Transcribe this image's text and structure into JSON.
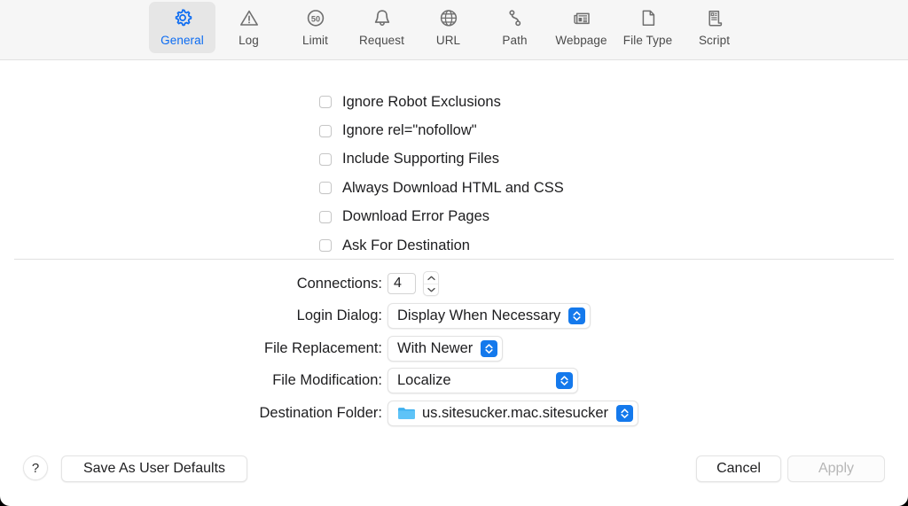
{
  "window": {
    "accent_color": "#1479ec",
    "toolbar_bg": "#f6f6f6"
  },
  "toolbar": {
    "tabs": [
      {
        "label": "General",
        "icon": "gear-icon",
        "selected": true
      },
      {
        "label": "Log",
        "icon": "warning-triangle-icon",
        "selected": false
      },
      {
        "label": "Limit",
        "icon": "speed-limit-50-icon",
        "selected": false
      },
      {
        "label": "Request",
        "icon": "bell-icon",
        "selected": false
      },
      {
        "label": "URL",
        "icon": "globe-icon",
        "selected": false
      },
      {
        "label": "Path",
        "icon": "path-node-icon",
        "selected": false
      },
      {
        "label": "Webpage",
        "icon": "newspaper-icon",
        "selected": false
      },
      {
        "label": "File Type",
        "icon": "document-page-icon",
        "selected": false
      },
      {
        "label": "Script",
        "icon": "scroll-script-icon",
        "selected": false
      }
    ]
  },
  "checkboxes": [
    {
      "label": "Ignore Robot Exclusions",
      "checked": false
    },
    {
      "label": "Ignore rel=\"nofollow\"",
      "checked": false
    },
    {
      "label": "Include Supporting Files",
      "checked": false
    },
    {
      "label": "Always Download HTML and CSS",
      "checked": false
    },
    {
      "label": "Download Error Pages",
      "checked": false
    },
    {
      "label": "Ask For Destination",
      "checked": false
    }
  ],
  "form": {
    "connections": {
      "label": "Connections:",
      "value": "4"
    },
    "login_dialog": {
      "label": "Login Dialog:",
      "value": "Display When Necessary"
    },
    "file_replacement": {
      "label": "File Replacement:",
      "value": "With Newer"
    },
    "file_modification": {
      "label": "File Modification:",
      "value": "Localize"
    },
    "destination_folder": {
      "label": "Destination Folder:",
      "value": "us.sitesucker.mac.sitesucker",
      "icon": "folder-icon"
    }
  },
  "bottom_bar": {
    "help_label": "?",
    "save_defaults_label": "Save As User Defaults",
    "cancel_label": "Cancel",
    "apply_label": "Apply",
    "apply_enabled": false
  }
}
